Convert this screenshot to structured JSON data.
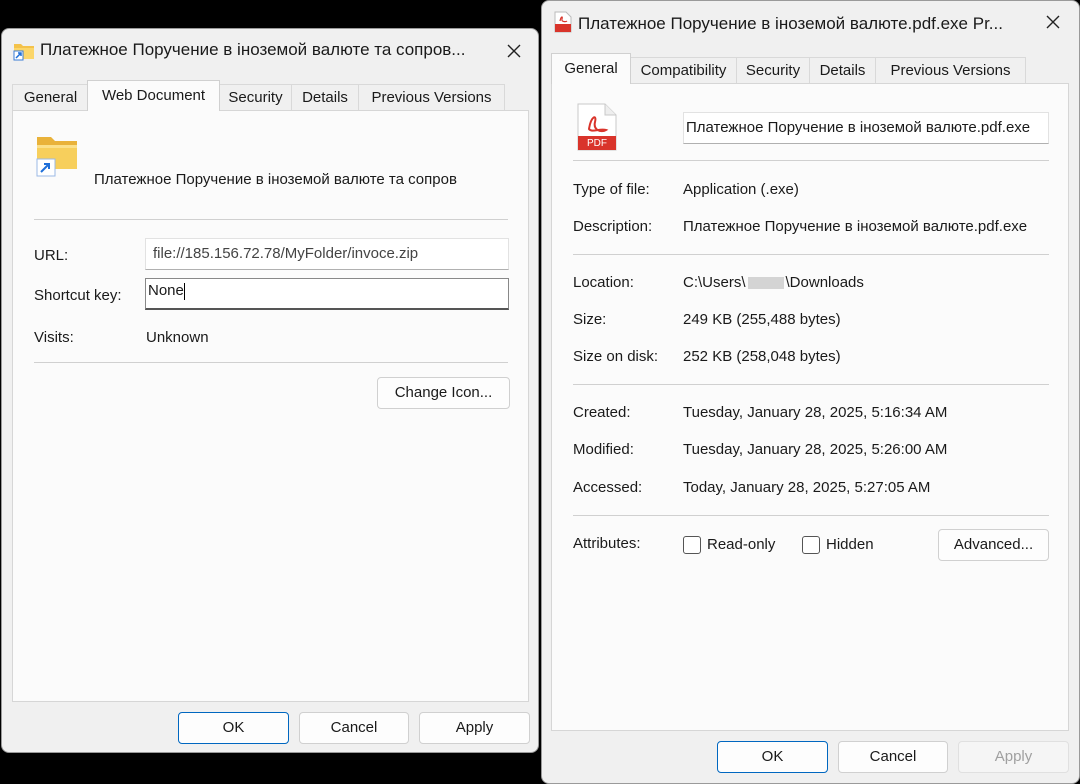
{
  "left_dialog": {
    "title": "Платежное Поручение в іноземой валюте та сопров...",
    "tabs": [
      "General",
      "Web Document",
      "Security",
      "Details",
      "Previous Versions"
    ],
    "active_tab": "Web Document",
    "name": "Платежное Поручение в іноземой валюте та сопров",
    "url_label": "URL:",
    "url_value": "file://185.156.72.78/MyFolder/invoce.zip",
    "shortcut_label": "Shortcut key:",
    "shortcut_value": "None",
    "visits_label": "Visits:",
    "visits_value": "Unknown",
    "change_icon_label": "Change Icon...",
    "ok_label": "OK",
    "cancel_label": "Cancel",
    "apply_label": "Apply"
  },
  "right_dialog": {
    "title": "Платежное Поручение в іноземой валюте.pdf.exe Pr...",
    "tabs": [
      "General",
      "Compatibility",
      "Security",
      "Details",
      "Previous Versions"
    ],
    "active_tab": "General",
    "filename": "Платежное Поручение в іноземой валюте.pdf.exe",
    "type_label": "Type of file:",
    "type_value": "Application (.exe)",
    "description_label": "Description:",
    "description_value": "Платежное Поручение в іноземой валюте.pdf.exe",
    "location_label": "Location:",
    "location_prefix": "C:\\Users\\",
    "location_suffix": "\\Downloads",
    "size_label": "Size:",
    "size_value": "249 KB (255,488 bytes)",
    "size_on_disk_label": "Size on disk:",
    "size_on_disk_value": "252 KB (258,048 bytes)",
    "created_label": "Created:",
    "created_value": "Tuesday, January 28, 2025, 5:16:34 AM",
    "modified_label": "Modified:",
    "modified_value": "Tuesday, January 28, 2025, 5:26:00 AM",
    "accessed_label": "Accessed:",
    "accessed_value": "Today, January 28, 2025, 5:27:05 AM",
    "attributes_label": "Attributes:",
    "readonly_label": "Read-only",
    "hidden_label": "Hidden",
    "advanced_label": "Advanced...",
    "pdf_icon_text": "PDF",
    "ok_label": "OK",
    "cancel_label": "Cancel",
    "apply_label": "Apply"
  },
  "colors": {
    "pdf_red": "#d9342b",
    "folder_yellow": "#f4c24a",
    "accent_blue": "#0067c0"
  }
}
